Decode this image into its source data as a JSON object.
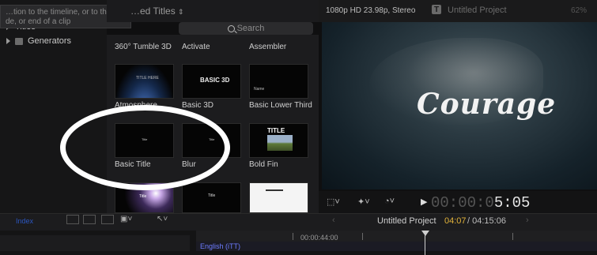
{
  "sidebar": {
    "tooltip": "…tion to the timeline, or to the …de, or end of a clip",
    "items": [
      {
        "label": "Titles"
      },
      {
        "label": "Generators"
      }
    ]
  },
  "browser": {
    "title": "…ed Titles",
    "search_placeholder": "Search",
    "items": [
      {
        "label": "360° Tumble 3D",
        "thumb_text": ""
      },
      {
        "label": "Activate",
        "thumb_text": ""
      },
      {
        "label": "Assembler",
        "thumb_text": ""
      },
      {
        "label": "Atmosphere",
        "thumb_text": "TITLE HERE"
      },
      {
        "label": "Basic 3D",
        "thumb_text": "BASIC 3D"
      },
      {
        "label": "Basic Lower Third",
        "thumb_text": "Name"
      },
      {
        "label": "Basic Title",
        "thumb_text": "Title"
      },
      {
        "label": "Blur",
        "thumb_text": "Title"
      },
      {
        "label": "Bold Fin",
        "thumb_text": "TITLE"
      },
      {
        "label": "",
        "thumb_text": "Title"
      },
      {
        "label": "",
        "thumb_text": "Title"
      },
      {
        "label": "",
        "thumb_text": ""
      }
    ]
  },
  "viewer": {
    "format": "1080p HD 23.98p, Stereo",
    "project_title": "Untitled Project",
    "zoom": "62%",
    "video_title": "Courage",
    "timecode_dim": "00:00:0",
    "timecode_bright": "5:05"
  },
  "timeline": {
    "index_label": "Index",
    "project_name": "Untitled Project",
    "current_time": "04:07",
    "total_time": "/ 04:15:06",
    "ruler_time": "00:00:44:00",
    "caption_lane": "English (iTT)"
  },
  "colors": {
    "accent_yellow": "#e1b23a",
    "caption_blue": "#6d7cff",
    "highlight_circle": "#ffffff"
  }
}
